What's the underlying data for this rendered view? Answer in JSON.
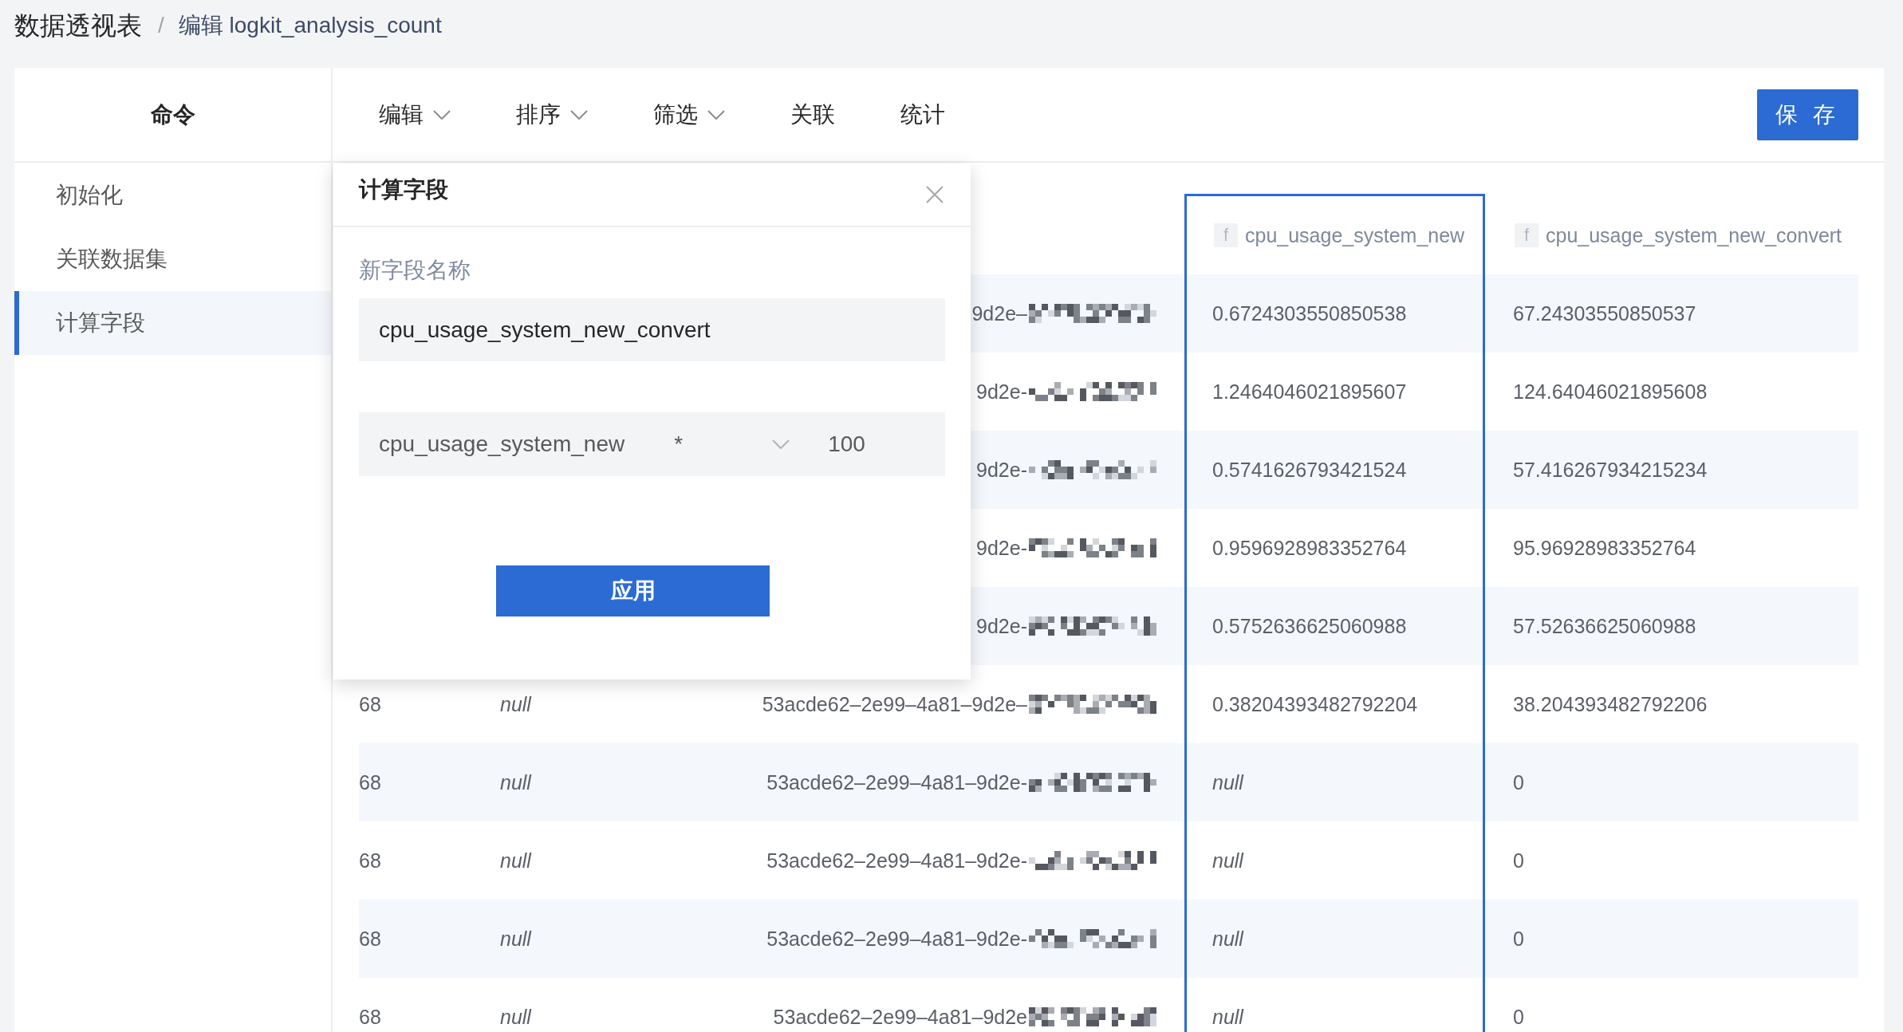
{
  "breadcrumb": {
    "items": [
      "数据透视表",
      "编辑 logkit_analysis_count"
    ],
    "separator": "/"
  },
  "sidebar": {
    "title": "命令",
    "items": [
      {
        "label": "初始化",
        "selected": false
      },
      {
        "label": "关联数据集",
        "selected": false
      },
      {
        "label": "计算字段",
        "selected": true
      }
    ]
  },
  "toolbar": {
    "items": [
      {
        "label": "编辑",
        "dropdown": true
      },
      {
        "label": "排序",
        "dropdown": true
      },
      {
        "label": "筛选",
        "dropdown": true
      },
      {
        "label": "关联",
        "dropdown": false
      },
      {
        "label": "统计",
        "dropdown": false
      }
    ],
    "save_button": "保 存"
  },
  "dialog": {
    "title": "计算字段",
    "field_label": "新字段名称",
    "name_value": "cpu_usage_system_new_convert",
    "expression": {
      "field": "cpu_usage_system_new",
      "operator": "*",
      "operand": "100"
    },
    "apply_button": "应用"
  },
  "table": {
    "columns": [
      {
        "type_label": "f",
        "title": "cpu_usage_system_new",
        "selected": true
      },
      {
        "type_label": "f",
        "title": "cpu_usage_system_new_convert",
        "selected": false
      }
    ],
    "rows": [
      {
        "column_3": "9d2e–",
        "values": [
          {
            "kind": "number",
            "text": "0.6724303550850538"
          },
          {
            "kind": "number",
            "text": "67.24303550850537"
          }
        ]
      },
      {
        "column_3": "9d2e-",
        "values": [
          {
            "kind": "number",
            "text": "1.2464046021895607"
          },
          {
            "kind": "number",
            "text": "124.64046021895608"
          }
        ]
      },
      {
        "column_3": "9d2e-",
        "values": [
          {
            "kind": "number",
            "text": "0.5741626793421524"
          },
          {
            "kind": "number",
            "text": "57.416267934215234"
          }
        ]
      },
      {
        "column_3": "9d2e-",
        "values": [
          {
            "kind": "number",
            "text": "0.9596928983352764"
          },
          {
            "kind": "number",
            "text": "95.96928983352764"
          }
        ]
      },
      {
        "column_3": "9d2e-",
        "values": [
          {
            "kind": "number",
            "text": "0.5752636625060988"
          },
          {
            "kind": "number",
            "text": "57.52636625060988"
          }
        ]
      },
      {
        "column_1": "68",
        "column_2": {
          "kind": "null",
          "text": "null"
        },
        "column_3": "53acde62–2e99–4a81–9d2e–",
        "values": [
          {
            "kind": "number",
            "text": "0.38204393482792204"
          },
          {
            "kind": "number",
            "text": "38.204393482792206"
          }
        ]
      },
      {
        "column_1": "68",
        "column_2": {
          "kind": "null",
          "text": "null"
        },
        "column_3": "53acde62–2e99–4a81–9d2e-",
        "values": [
          {
            "kind": "null",
            "text": "null"
          },
          {
            "kind": "number",
            "text": "0"
          }
        ]
      },
      {
        "column_1": "68",
        "column_2": {
          "kind": "null",
          "text": "null"
        },
        "column_3": "53acde62–2e99–4a81–9d2e-",
        "values": [
          {
            "kind": "null",
            "text": "null"
          },
          {
            "kind": "number",
            "text": "0"
          }
        ]
      },
      {
        "column_1": "68",
        "column_2": {
          "kind": "null",
          "text": "null"
        },
        "column_3": "53acde62–2e99–4a81–9d2e-",
        "values": [
          {
            "kind": "null",
            "text": "null"
          },
          {
            "kind": "number",
            "text": "0"
          }
        ]
      },
      {
        "column_1": "68",
        "column_2": {
          "kind": "null",
          "text": "null"
        },
        "column_3": "53acde62–2e99–4a81–9d2e",
        "values": [
          {
            "kind": "null",
            "text": "null"
          },
          {
            "kind": "number",
            "text": "0"
          }
        ]
      }
    ]
  }
}
